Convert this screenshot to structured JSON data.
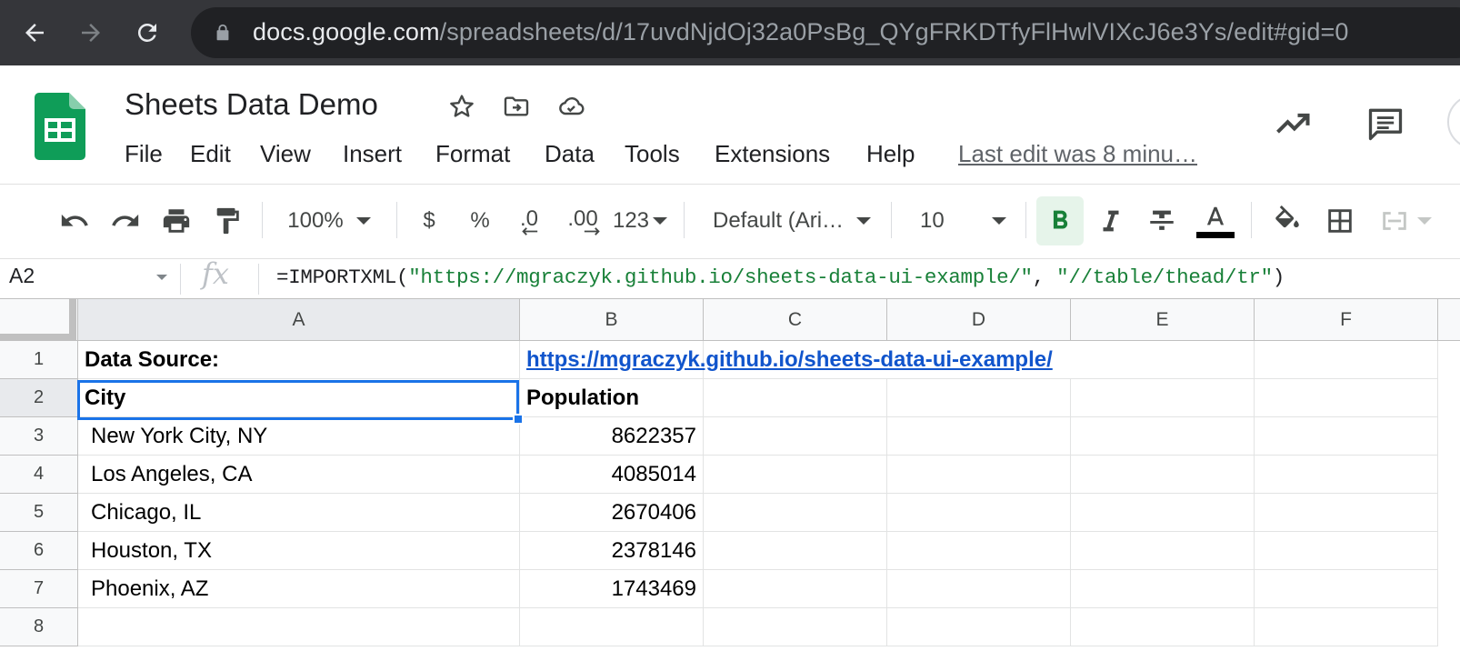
{
  "browser": {
    "url_host": "docs.google.com",
    "url_path": "/spreadsheets/d/17uvdNjdOj32a0PsBg_QYgFRKDTfyFlHwlVIXcJ6e3Ys/edit#gid=0",
    "icons": [
      "back-arrow-icon",
      "forward-arrow-icon",
      "reload-icon",
      "lock-icon"
    ]
  },
  "header": {
    "title": "Sheets Data Demo",
    "icons": [
      "star-icon",
      "move-folder-icon",
      "cloud-saved-icon",
      "activity-trend-icon",
      "comment-icon"
    ],
    "last_edit": "Last edit was 8 minu…"
  },
  "menu": {
    "file": "File",
    "edit": "Edit",
    "view": "View",
    "insert": "Insert",
    "format": "Format",
    "data": "Data",
    "tools": "Tools",
    "extensions": "Extensions",
    "help": "Help"
  },
  "toolbar": {
    "zoom": "100%",
    "currency": "$",
    "percent": "%",
    "decrease_decimal": ".0",
    "increase_decimal": ".00",
    "more_formats": "123",
    "font": "Default (Ari…",
    "font_size": "10",
    "bold_active": true,
    "text_color": "#000000"
  },
  "formula_bar": {
    "cell_ref": "A2",
    "formula_prefix": "=IMPORTXML(",
    "formula_arg1": "\"https://mgraczyk.github.io/sheets-data-ui-example/\"",
    "formula_sep": ", ",
    "formula_arg2": "\"//table/thead/tr\"",
    "formula_suffix": ")"
  },
  "grid": {
    "columns": [
      "A",
      "B",
      "C",
      "D",
      "E",
      "F"
    ],
    "rows": [
      "1",
      "2",
      "3",
      "4",
      "5",
      "6",
      "7",
      "8"
    ],
    "selected_cell": "A2",
    "cells": {
      "A1": "Data Source:",
      "B1": "https://mgraczyk.github.io/sheets-data-ui-example/",
      "A2": "City",
      "B2": "Population",
      "A3": "New York City, NY",
      "B3": "8622357",
      "A4": "Los Angeles, CA",
      "B4": "4085014",
      "A5": "Chicago, IL",
      "B5": "2670406",
      "A6": "Houston, TX",
      "B6": "2378146",
      "A7": "Phoenix, AZ",
      "B7": "1743469"
    }
  },
  "colors": {
    "accent": "#1a73e8",
    "link": "#1155cc",
    "formula_string": "#188038",
    "sheets_green": "#0f9d58"
  }
}
